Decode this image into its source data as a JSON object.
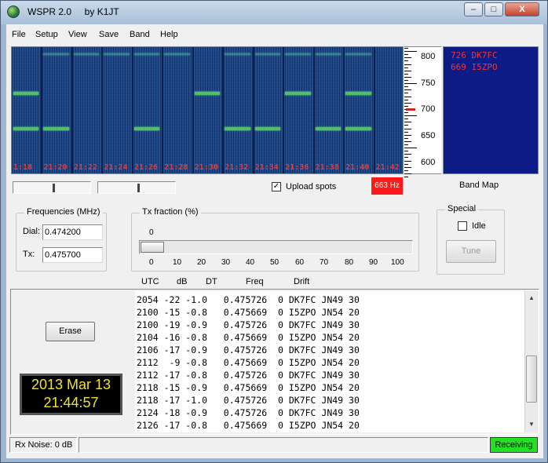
{
  "window": {
    "title": "WSPR 2.0     by K1JT",
    "controls": {
      "minimize": "–",
      "maximize": "□",
      "close": "X"
    }
  },
  "menu": [
    "File",
    "Setup",
    "View",
    "Save",
    "Band",
    "Help"
  ],
  "waterfall": {
    "times": [
      "1:18",
      "21:20",
      "21:22",
      "21:24",
      "21:26",
      "21:28",
      "21:30",
      "21:32",
      "21:34",
      "21:36",
      "21:38",
      "21:40",
      "21:42"
    ]
  },
  "freq_scale": {
    "labels": [
      "800",
      "750",
      "700",
      "650",
      "600"
    ],
    "marker_hz": 700
  },
  "bandmap": {
    "entries": [
      "726 DK7FC",
      "669 I5ZPO"
    ],
    "label": "Band Map"
  },
  "controls": {
    "upload_spots_label": "Upload spots",
    "upload_spots_checked": true,
    "freq_readout": "663 Hz"
  },
  "frequencies": {
    "title": "Frequencies (MHz)",
    "dial_label": "Dial:",
    "dial_value": "0.474200",
    "tx_label": "Tx:",
    "tx_value": "0.475700"
  },
  "tx_fraction": {
    "title": "Tx fraction (%)",
    "value": "0",
    "scale": [
      "0",
      "10",
      "20",
      "30",
      "40",
      "50",
      "60",
      "70",
      "80",
      "90",
      "100"
    ]
  },
  "special": {
    "title": "Special",
    "idle_label": "Idle",
    "idle_checked": false,
    "tune_label": "Tune"
  },
  "columns": [
    "UTC",
    "dB",
    "DT",
    "Freq",
    "Drift"
  ],
  "decodes": [
    "2054 -22 -1.0   0.475726  0 DK7FC JN49 30",
    "2100 -15 -0.8   0.475669  0 I5ZPO JN54 20",
    "2100 -19 -0.9   0.475726  0 DK7FC JN49 30",
    "2104 -16 -0.8   0.475669  0 I5ZPO JN54 20",
    "2106 -17 -0.9   0.475726  0 DK7FC JN49 30",
    "2112  -9 -0.8   0.475669  0 I5ZPO JN54 20",
    "2112 -17 -0.8   0.475726  0 DK7FC JN49 30",
    "2118 -15 -0.9   0.475669  0 I5ZPO JN54 20",
    "2118 -17 -1.0   0.475726  0 DK7FC JN49 30",
    "2124 -18 -0.9   0.475726  0 DK7FC JN49 30",
    "2126 -17 -0.8   0.475669  0 I5ZPO JN54 20"
  ],
  "erase_label": "Erase",
  "clock": {
    "date": "2013 Mar 13",
    "time": "21:44:57"
  },
  "status": {
    "rx_noise": "Rx Noise: 0 dB",
    "state": "Receiving"
  },
  "colors": {
    "waterfall_bg": "#1d4788",
    "bandmap_bg": "#0d1b86",
    "clock_text": "#f3e12a",
    "receiving": "#22e022",
    "freq_badge": "#ff1a1a"
  }
}
